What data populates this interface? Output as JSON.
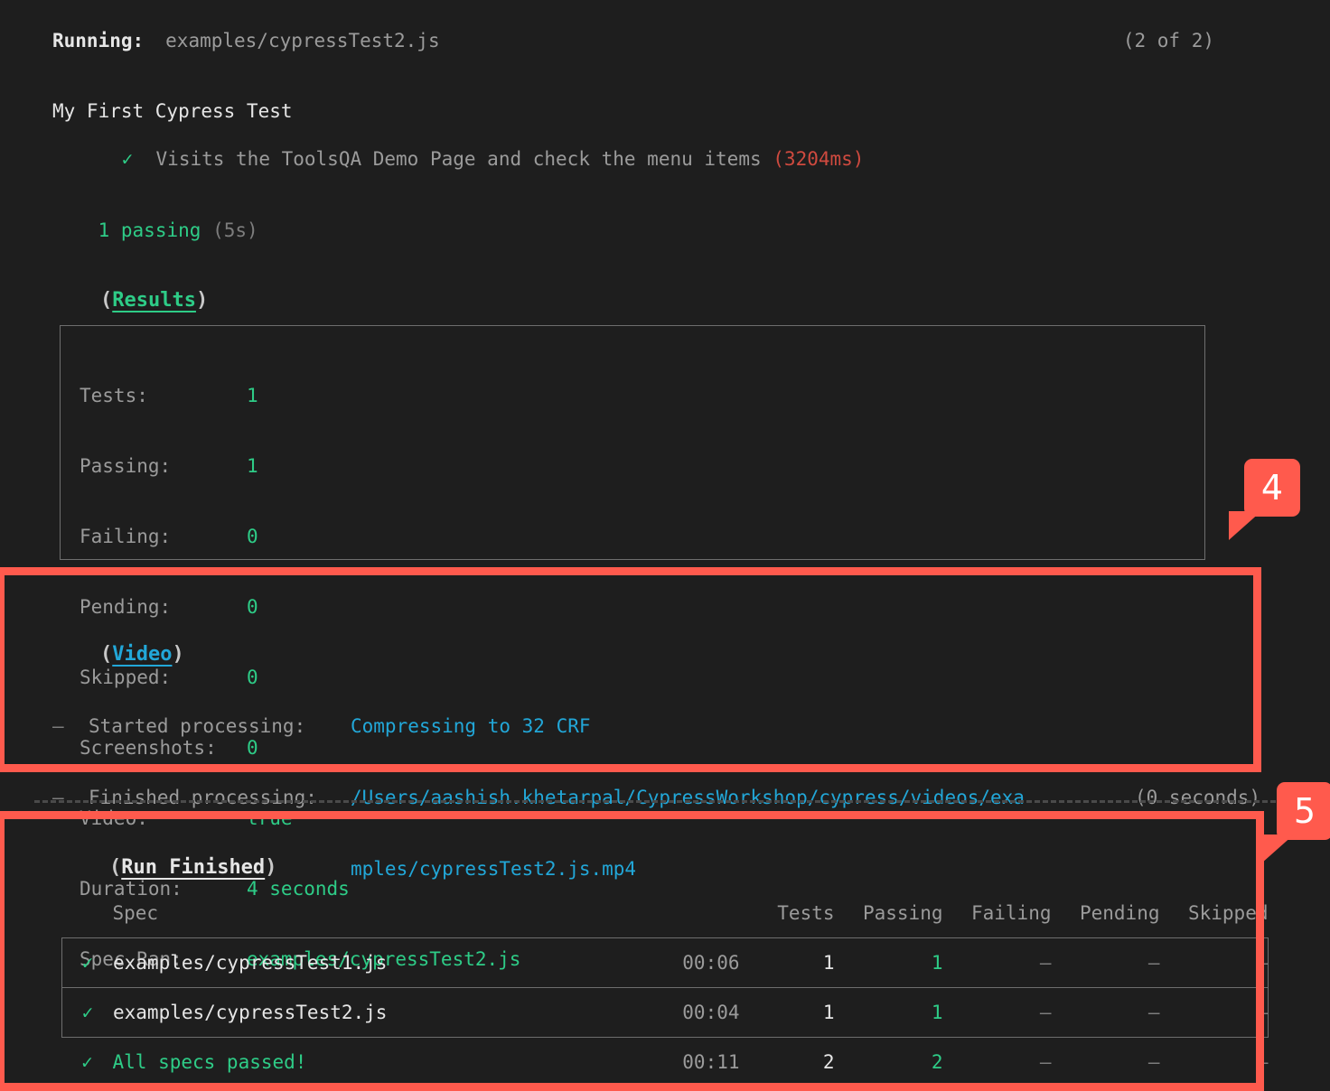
{
  "header": {
    "running_label": "Running:",
    "spec": "examples/cypressTest2.js",
    "progress": "(2 of 2)"
  },
  "suite": {
    "title": "My First Cypress Test",
    "tick": "✓",
    "test_description": "Visits the ToolsQA Demo Page and check the menu items",
    "test_duration": "(3204ms)"
  },
  "summary_line": {
    "count": "1",
    "label": "passing",
    "duration": "(5s)"
  },
  "results": {
    "heading_open": "(",
    "heading_word": "Results",
    "heading_close": ")",
    "rows": [
      {
        "key": "Tests:",
        "value": "1"
      },
      {
        "key": "Passing:",
        "value": "1"
      },
      {
        "key": "Failing:",
        "value": "0"
      },
      {
        "key": "Pending:",
        "value": "0"
      },
      {
        "key": "Skipped:",
        "value": "0"
      },
      {
        "key": "Screenshots:",
        "value": "0"
      },
      {
        "key": "Video:",
        "value": "true"
      },
      {
        "key": "Duration:",
        "value": "4 seconds"
      },
      {
        "key": "Spec Ran:",
        "value": "examples/cypressTest2.js"
      }
    ]
  },
  "video": {
    "heading_open": "(",
    "heading_word": "Video",
    "heading_close": ")",
    "dash": "–",
    "started_label": "Started processing:",
    "started_value": "Compressing to 32 CRF",
    "finished_label": "Finished processing:",
    "finished_value": "/Users/aashish.khetarpal/CypressWorkshop/cypress/videos/exa",
    "finished_value_wrap": "mples/cypressTest2.js.mp4",
    "finished_time": "(0 seconds)"
  },
  "run_finished": {
    "heading_open": "(",
    "heading_word": "Run Finished",
    "heading_close": ")",
    "columns": [
      "Spec",
      "Tests",
      "Passing",
      "Failing",
      "Pending",
      "Skipped"
    ],
    "rows": [
      {
        "tick": "✓",
        "spec": "examples/cypressTest1.js",
        "time": "00:06",
        "tests": "1",
        "passing": "1",
        "failing": "–",
        "pending": "–",
        "skipped": "–"
      },
      {
        "tick": "✓",
        "spec": "examples/cypressTest2.js",
        "time": "00:04",
        "tests": "1",
        "passing": "1",
        "failing": "–",
        "pending": "–",
        "skipped": "–"
      }
    ],
    "total": {
      "tick": "✓",
      "spec": "All specs passed!",
      "time": "00:11",
      "tests": "2",
      "passing": "2",
      "failing": "–",
      "pending": "–",
      "skipped": "–"
    }
  },
  "annotations": {
    "badge_video": "4",
    "badge_run_finished": "5",
    "highlight_color": "#ff5a4d"
  },
  "colors": {
    "background": "#1e1e1e",
    "pass_green": "#2ecc87",
    "fail_red": "#cf4a3f",
    "link_cyan": "#22a7d8",
    "muted": "#9b9b9b"
  }
}
